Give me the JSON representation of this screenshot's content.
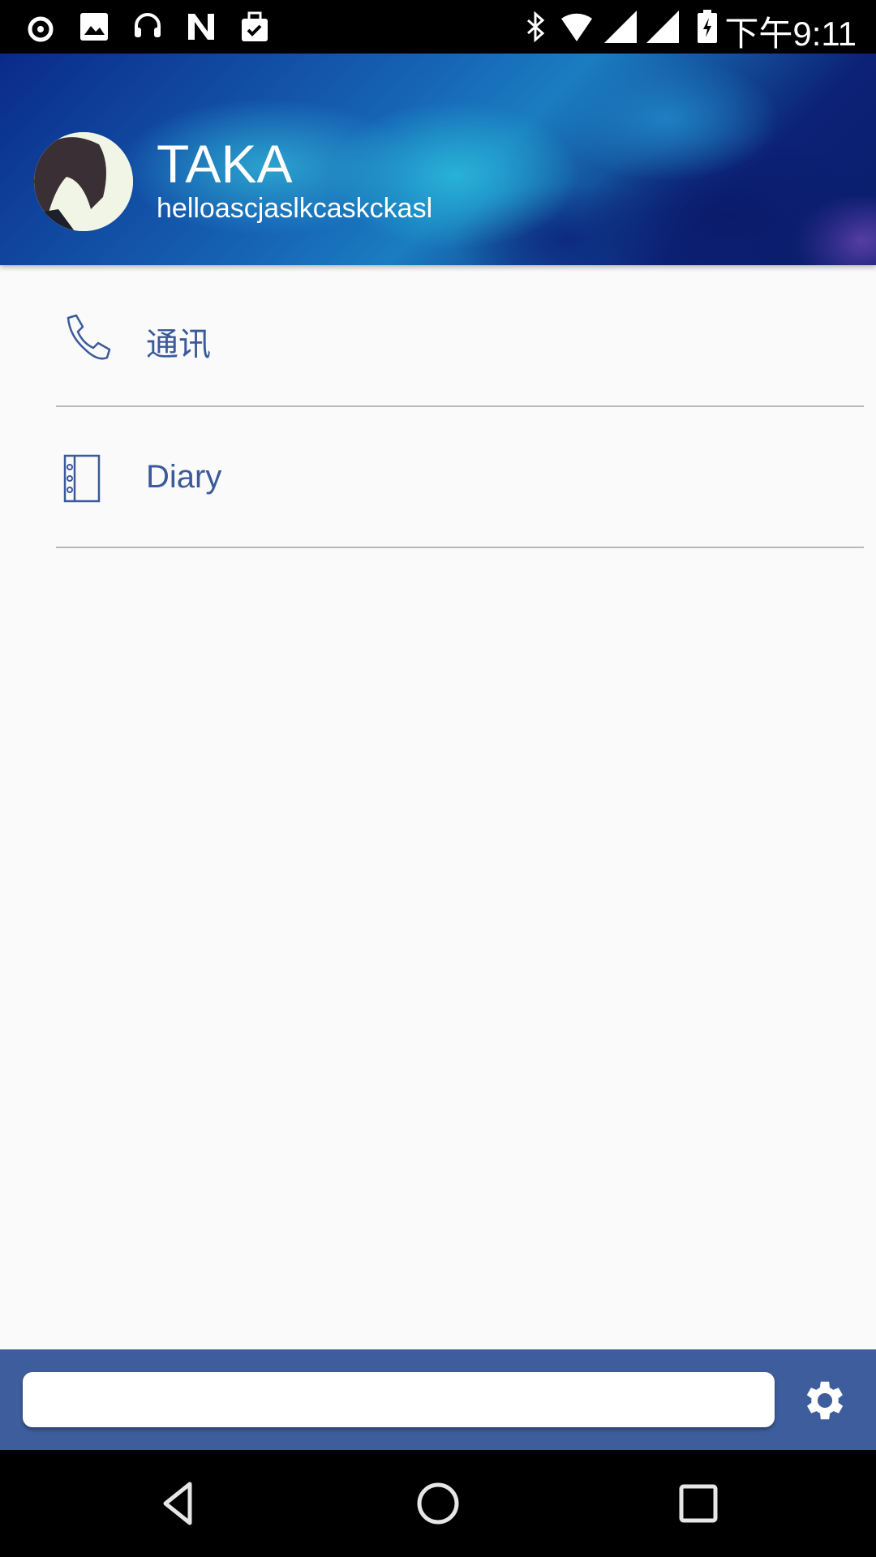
{
  "status_bar": {
    "time": "下午9:11",
    "icons": [
      "netease-music-icon",
      "image-icon",
      "headset-icon",
      "n-app-icon",
      "briefcase-check-icon",
      "bluetooth-icon",
      "wifi-alert-icon",
      "signal-icon",
      "signal-icon",
      "battery-charging-icon"
    ]
  },
  "profile": {
    "name": "TAKA",
    "subtitle": "helloascjaslkcaskckasl"
  },
  "menu": {
    "items": [
      {
        "label": "通讯",
        "icon": "phone-icon"
      },
      {
        "label": "Diary",
        "icon": "notebook-icon"
      }
    ]
  },
  "bottom": {
    "input_value": "",
    "input_placeholder": ""
  },
  "colors": {
    "accent": "#3d5d9c",
    "text": "#3b5a9a",
    "background": "#fafafa"
  }
}
